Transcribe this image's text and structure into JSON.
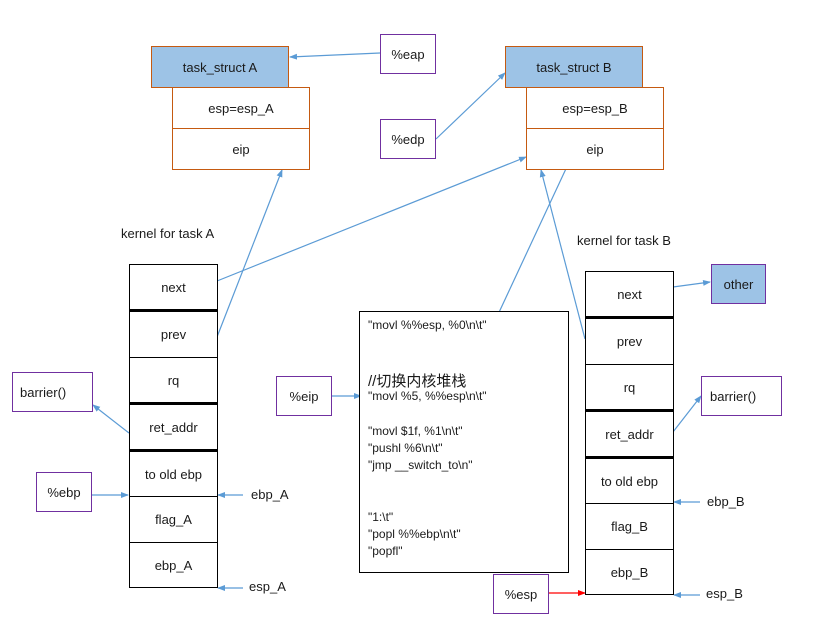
{
  "task_struct_a": {
    "title": "task_struct A",
    "fields": [
      "esp=esp_A",
      "eip"
    ]
  },
  "task_struct_b": {
    "title": "task_struct B",
    "fields": [
      "esp=esp_B",
      "eip"
    ]
  },
  "registers": {
    "eap": "%eap",
    "edp": "%edp",
    "eip": "%eip",
    "ebp": "%ebp",
    "esp": "%esp"
  },
  "stack_a": {
    "title": "kernel for task A",
    "slots": [
      "next",
      "prev",
      "rq",
      "ret_addr",
      "to old ebp",
      "flag_A",
      "ebp_A"
    ],
    "ebp_marker": "ebp_A",
    "esp_marker": "esp_A",
    "barrier": "barrier()"
  },
  "stack_b": {
    "title": "kernel for task B",
    "slots": [
      "next",
      "prev",
      "rq",
      "ret_addr",
      "to old ebp",
      "flag_B",
      "ebp_B"
    ],
    "ebp_marker": "ebp_B",
    "esp_marker": "esp_B",
    "barrier": "barrier()",
    "other": "other"
  },
  "code_block": {
    "lines": [
      "\"movl %%esp, %0\\n\\t\"",
      "//切换内核堆栈",
      "\"movl %5, %%esp\\n\\t\"",
      "\"movl $1f, %1\\n\\t\"",
      "\"pushl %6\\n\\t\"",
      "\"jmp __switch_to\\n\"",
      "\"1:\\t\"",
      "\"popl %%ebp\\n\\t\"",
      "\"popfl\""
    ]
  },
  "colors": {
    "struct_fill": "#9dc3e6",
    "struct_border": "#c55a11",
    "register_border": "#7030a0",
    "arrow": "#5b9bd5",
    "esp_arrow": "#ff0000"
  }
}
